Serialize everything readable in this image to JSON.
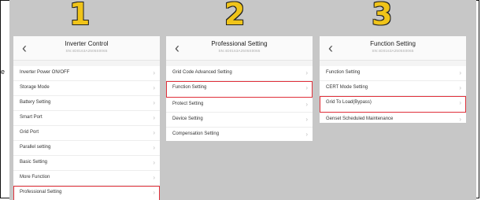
{
  "steps": [
    "1",
    "2",
    "3"
  ],
  "edge_text": "e",
  "panels": [
    {
      "title": "Inverter Control",
      "serial": "SN:4D0163A2505S0065",
      "items": [
        {
          "label": "Inverter Power ON/OFF"
        },
        {
          "label": "Storage Mode"
        },
        {
          "label": "Battery Setting"
        },
        {
          "label": "Smart Port"
        },
        {
          "label": "Grid Port"
        },
        {
          "label": "Parallel setting"
        },
        {
          "label": "Basic Setting"
        },
        {
          "label": "More Function"
        },
        {
          "label": "Professional Setting"
        }
      ],
      "highlighted": "Professional Setting"
    },
    {
      "title": "Professional Setting",
      "serial": "SN:4D0163A2505S0065",
      "items": [
        {
          "label": "Grid Code Advanced Setting"
        },
        {
          "label": "Function Setting"
        },
        {
          "label": "Protect Setting"
        },
        {
          "label": "Device Setting"
        },
        {
          "label": "Compensation Setting"
        }
      ],
      "highlighted": "Function Setting"
    },
    {
      "title": "Function Setting",
      "serial": "SN:4D0163A2505S0065",
      "items": [
        {
          "label": "Function Setting"
        },
        {
          "label": "CERT Mode Setting"
        },
        {
          "label": "Grid To Load(Bypass)"
        },
        {
          "label": "Genset Scheduled Maintenance"
        }
      ],
      "highlighted": "Grid To Load(Bypass)"
    }
  ],
  "icons": {
    "back": "chevron-left-icon",
    "row": "chevron-right-icon"
  },
  "colors": {
    "highlight": "#e0303a",
    "step_number": "#f0c419",
    "background": "#c7c7c7"
  }
}
